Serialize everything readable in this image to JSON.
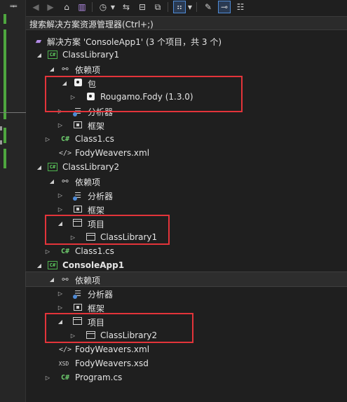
{
  "left_strip": {
    "glyph": "ᆍ"
  },
  "toolbar": {
    "icons": [
      "back-arrow-icon",
      "forward-arrow-icon",
      "home-icon",
      "vs-switch-view-icon",
      "history-icon",
      "sync-arrows-icon",
      "collapse-all-icon",
      "copy-icon",
      "show-all-files-icon",
      "wrench-icon",
      "preview-icon",
      "hierarchy-icon"
    ]
  },
  "search": {
    "placeholder": "搜索解决方案资源管理器(Ctrl+;)"
  },
  "tree": {
    "solution": "解决方案 'ConsoleApp1' (3 个项目，共 3 个)",
    "classlibrary1": {
      "name": "ClassLibrary1",
      "dependencies": "依赖项",
      "packages": "包",
      "package_item": "Rougamo.Fody (1.3.0)",
      "analyzers": "分析器",
      "frameworks": "框架",
      "class_file": "Class1.cs",
      "weavers": "FodyWeavers.xml"
    },
    "classlibrary2": {
      "name": "ClassLibrary2",
      "dependencies": "依赖项",
      "analyzers": "分析器",
      "frameworks": "框架",
      "projects": "项目",
      "project_ref": "ClassLibrary1",
      "class_file": "Class1.cs"
    },
    "consoleapp1": {
      "name": "ConsoleApp1",
      "dependencies": "依赖项",
      "analyzers": "分析器",
      "frameworks": "框架",
      "projects": "项目",
      "project_ref": "ClassLibrary2",
      "weavers_xml": "FodyWeavers.xml",
      "weavers_xsd": "FodyWeavers.xsd",
      "program_file": "Program.cs"
    },
    "icon_text": {
      "project": "C#",
      "cs": "C#",
      "xml": "</>",
      "xsd": "XSD"
    }
  },
  "colors": {
    "highlight_box": "#e3343a",
    "accent_green": "#4ea63f",
    "solution_purple": "#b48ce8"
  }
}
